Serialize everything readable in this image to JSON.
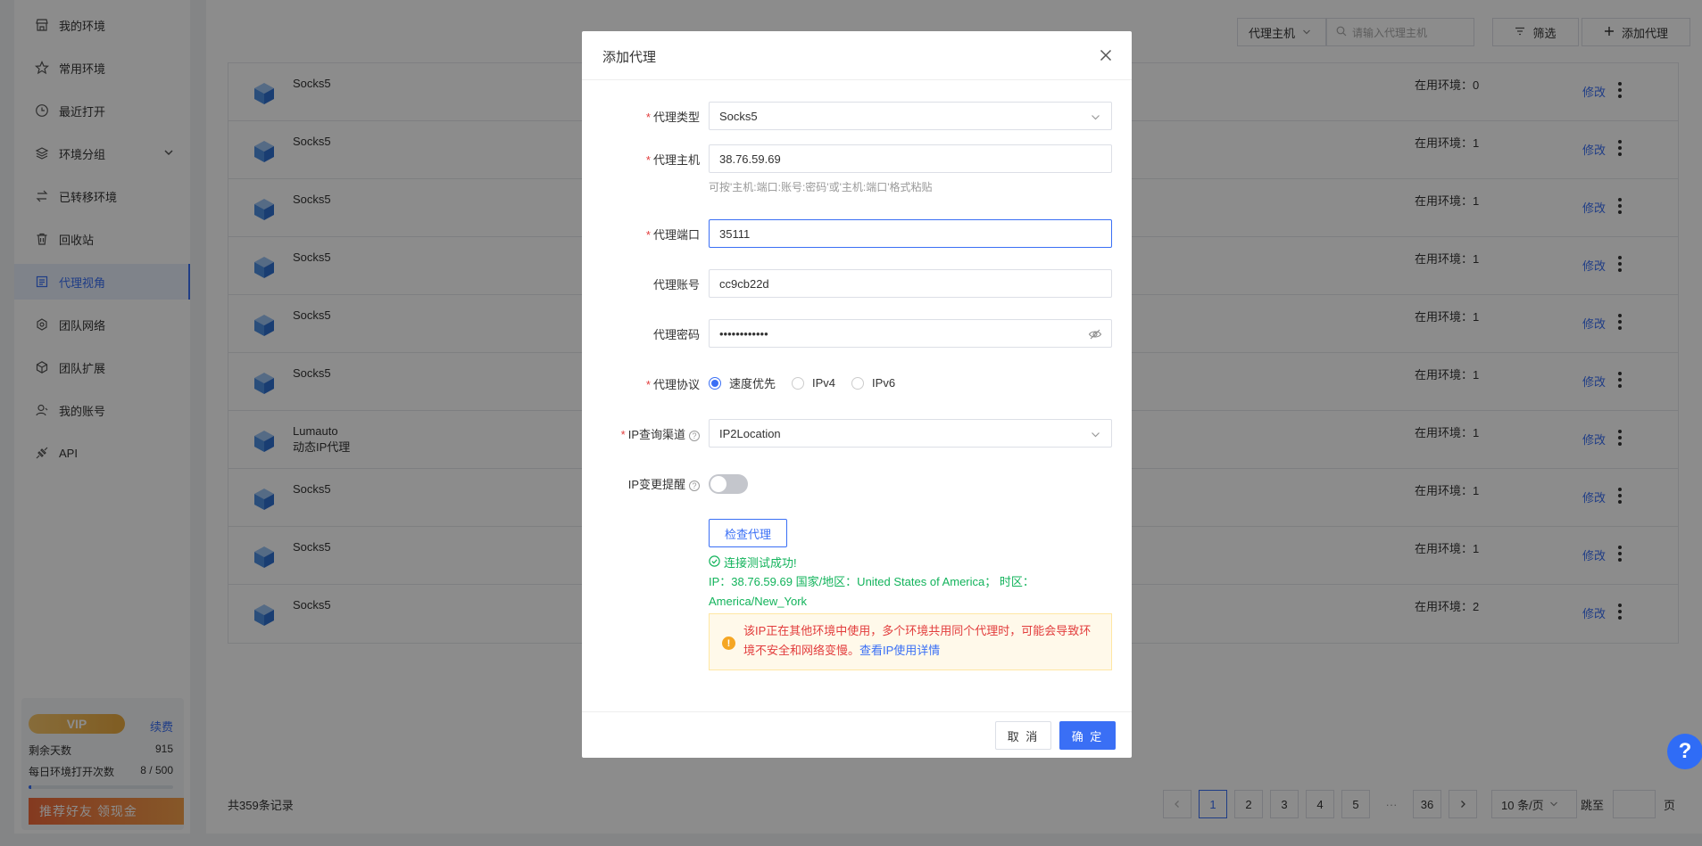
{
  "sidebar": {
    "items": [
      {
        "label": "我的环境",
        "icon": "store-icon"
      },
      {
        "label": "常用环境",
        "icon": "star-icon"
      },
      {
        "label": "最近打开",
        "icon": "clock-icon"
      },
      {
        "label": "环境分组",
        "icon": "layers-icon"
      },
      {
        "label": "已转移环境",
        "icon": "transfer-icon"
      },
      {
        "label": "回收站",
        "icon": "trash-icon"
      },
      {
        "label": "代理视角",
        "icon": "proxy-icon",
        "active": true
      },
      {
        "label": "团队网络",
        "icon": "network-icon"
      },
      {
        "label": "团队扩展",
        "icon": "extension-icon"
      },
      {
        "label": "我的账号",
        "icon": "user-icon"
      },
      {
        "label": "API",
        "icon": "api-icon"
      }
    ],
    "vip": {
      "badge": "VIP",
      "renew": "续费",
      "days_label": "剩余天数",
      "days_value": "915",
      "opens_label": "每日环境打开次数",
      "opens_value": "8 / 500",
      "opens_progress": 0.016,
      "refer": "推荐好友 领现金"
    }
  },
  "toolbar": {
    "host_select": "代理主机",
    "search_placeholder": "请输入代理主机",
    "filter": "筛选",
    "add": "添加代理"
  },
  "table": {
    "rows": [
      {
        "type": "Socks5",
        "sub": "",
        "in_use": "在用环境：0",
        "edit": "修改"
      },
      {
        "type": "Socks5",
        "sub": "",
        "in_use": "在用环境：1",
        "edit": "修改"
      },
      {
        "type": "Socks5",
        "sub": "",
        "in_use": "在用环境：1",
        "edit": "修改"
      },
      {
        "type": "Socks5",
        "sub": "",
        "in_use": "在用环境：1",
        "edit": "修改"
      },
      {
        "type": "Socks5",
        "sub": "",
        "in_use": "在用环境：1",
        "edit": "修改"
      },
      {
        "type": "Socks5",
        "sub": "",
        "in_use": "在用环境：1",
        "edit": "修改"
      },
      {
        "type": "Lumauto",
        "sub": "动态IP代理",
        "in_use": "在用环境：1",
        "edit": "修改"
      },
      {
        "type": "Socks5",
        "sub": "",
        "in_use": "在用环境：1",
        "edit": "修改"
      },
      {
        "type": "Socks5",
        "sub": "",
        "in_use": "在用环境：1",
        "edit": "修改"
      },
      {
        "type": "Socks5",
        "sub": "",
        "in_use": "在用环境：2",
        "edit": "修改"
      }
    ]
  },
  "footer": {
    "total": "共359条记录",
    "pages": [
      "1",
      "2",
      "3",
      "4",
      "5"
    ],
    "ellipsis": "···",
    "last_page": "36",
    "page_size": "10 条/页",
    "jump_label": "跳至",
    "page_unit": "页"
  },
  "dialog": {
    "title": "添加代理",
    "fields": {
      "type_label": "代理类型",
      "type_value": "Socks5",
      "host_label": "代理主机",
      "host_value": "38.76.59.69",
      "host_hint": "可按'主机:端口:账号:密码'或'主机:端口'格式粘贴",
      "port_label": "代理端口",
      "port_value": "35111",
      "account_label": "代理账号",
      "account_value": "cc9cb22d",
      "password_label": "代理密码",
      "password_value": "••••••••••••",
      "protocol_label": "代理协议",
      "protocol_options": [
        "速度优先",
        "IPv4",
        "IPv6"
      ],
      "protocol_selected": "速度优先",
      "channel_label": "IP查询渠道",
      "channel_value": "IP2Location",
      "alert_label": "IP变更提醒",
      "alert_on": false
    },
    "check_button": "检查代理",
    "success": "连接测试成功!",
    "ip_info": "IP：38.76.59.69 国家/地区：United States of America； 时区：America/New_York",
    "warning": "该IP正在其他环境中使用，多个环境共用同个代理时，可能会导致环境不安全和网络变慢。",
    "warning_link": "查看IP使用详情",
    "cancel": "取 消",
    "confirm": "确 定"
  },
  "help_fab": "?",
  "colors": {
    "accent": "#3a6ff5",
    "success": "#12b35b",
    "danger": "#e23c3c",
    "warning": "#f5a623"
  }
}
